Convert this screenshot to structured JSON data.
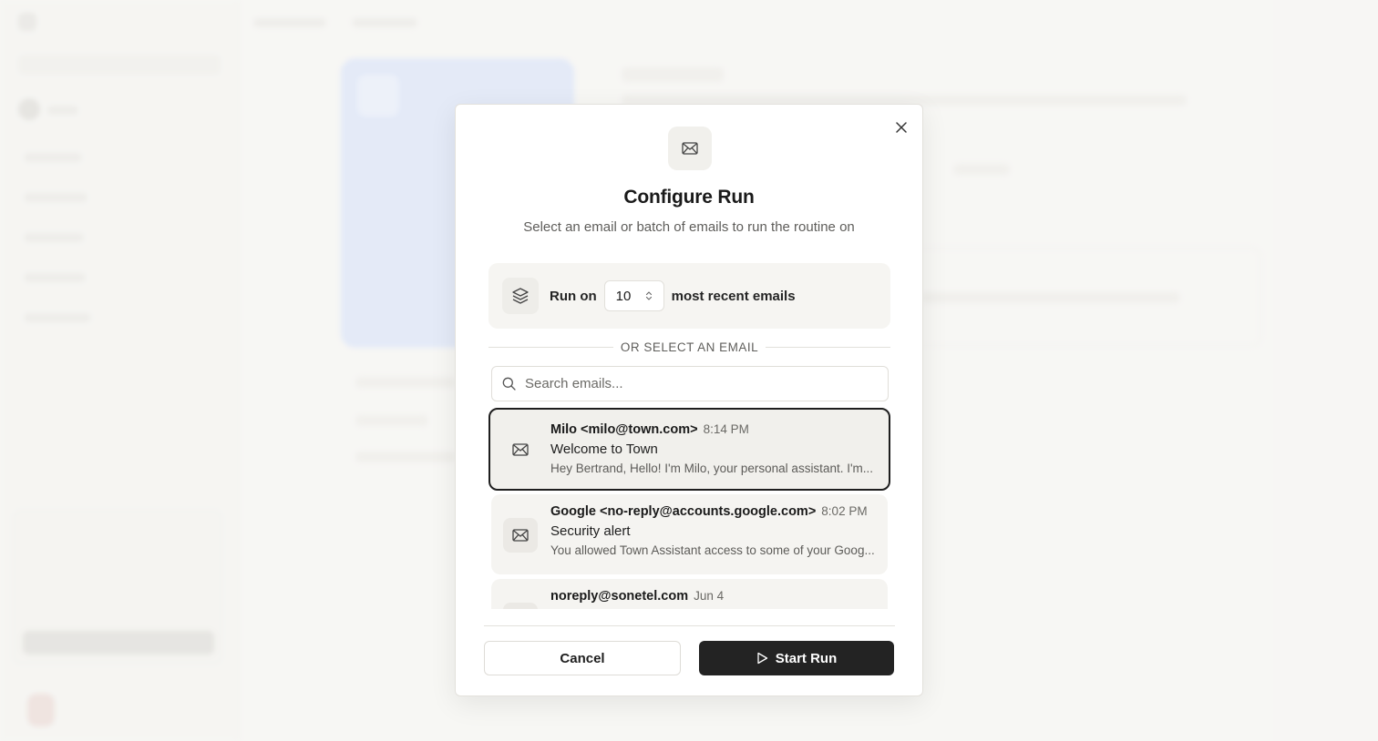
{
  "modal": {
    "title": "Configure Run",
    "subtitle": "Select an email or batch of emails to run the routine on",
    "header_icon": "mail-icon",
    "close_icon": "close-icon"
  },
  "batch": {
    "icon": "layers-icon",
    "prefix": "Run on",
    "count": "10",
    "suffix": "most recent emails"
  },
  "divider_text": "OR SELECT AN EMAIL",
  "search": {
    "placeholder": "Search emails...",
    "icon": "search-icon"
  },
  "emails": [
    {
      "from": "Milo <milo@town.com>",
      "time": "8:14 PM",
      "subject": "Welcome to Town",
      "preview": "Hey Bertrand, Hello! I'm Milo, your personal assistant. I'm...",
      "selected": true
    },
    {
      "from": "Google <no-reply@accounts.google.com>",
      "time": "8:02 PM",
      "subject": "Security alert",
      "preview": "You allowed Town Assistant access to some of your Goog...",
      "selected": false
    },
    {
      "from": "noreply@sonetel.com",
      "time": "Jun 4",
      "subject": "",
      "preview": "",
      "selected": false
    }
  ],
  "actions": {
    "cancel": "Cancel",
    "start": "Start Run",
    "start_icon": "play-icon"
  }
}
